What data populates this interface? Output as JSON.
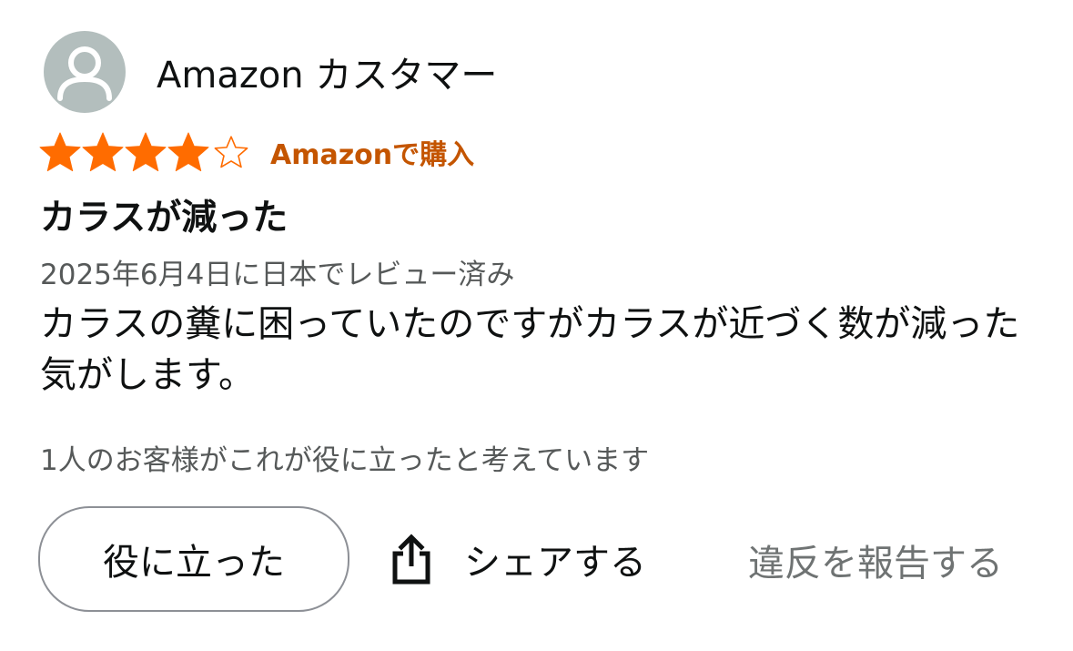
{
  "reviewer": {
    "name": "Amazon カスタマー",
    "avatar_icon": "default-user-avatar-icon"
  },
  "rating": {
    "stars": 4,
    "max_stars": 5,
    "filled_color": "#ff6c00",
    "empty_color": "#ff6c00"
  },
  "verified_label": "Amazonで購入",
  "colors": {
    "verified": "#c45500",
    "secondary_text": "#565959",
    "avatar_bg": "#b3bebd"
  },
  "review": {
    "title": "カラスが減った",
    "date": "2025年6月4日に日本でレビュー済み",
    "body": "カラスの糞に困っていたのですがカラスが近づく数が減った気がします。"
  },
  "helpful_count_text": "1人のお客様がこれが役に立ったと考えています",
  "actions": {
    "helpful_label": "役に立った",
    "share_label": "シェアする",
    "share_icon": "share-icon",
    "report_label": "違反を報告する"
  }
}
